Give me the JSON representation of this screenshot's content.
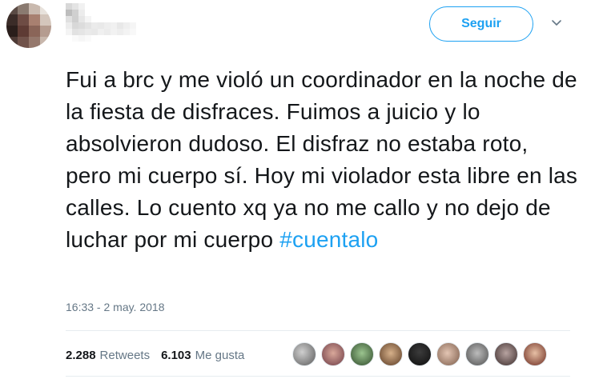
{
  "header": {
    "follow_label": "Seguir"
  },
  "tweet": {
    "text": "Fui a brc y me violó un coordinador en la noche de la fiesta de disfraces. Fuimos a juicio y lo absolvieron dudoso. El disfraz no estaba roto, pero mi cuerpo sí. Hoy mi violador esta libre en las calles. Lo cuento xq ya no me callo y no dejo de luchar por mi cuerpo ",
    "hashtag": "#cuentalo",
    "timestamp": "16:33 - 2 may. 2018"
  },
  "stats": {
    "retweets_count": "2.288",
    "retweets_label": "Retweets",
    "likes_count": "6.103",
    "likes_label": "Me gusta"
  },
  "icons": {
    "caret": "chevron-down-icon"
  },
  "colors": {
    "accent": "#1da1f2",
    "text": "#14171a",
    "muted": "#657786",
    "divider": "#e6ecf0"
  }
}
